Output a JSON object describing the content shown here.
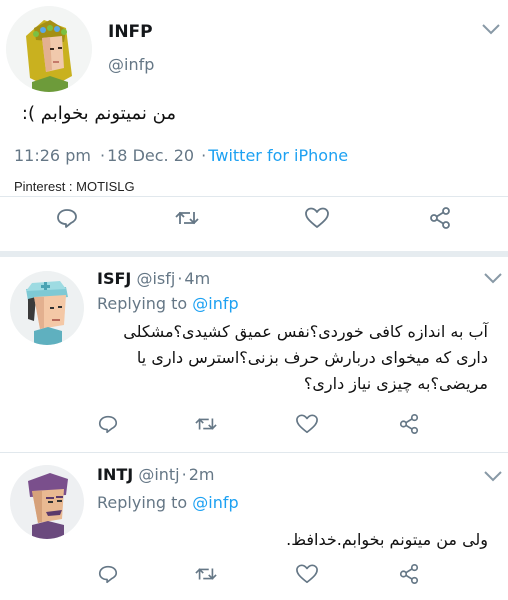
{
  "main_tweet": {
    "display_name": "INFP",
    "handle": "@infp",
    "text": "من نمیتونم بخوابم ):",
    "time": "11:26 pm",
    "date": "18 Dec. 20",
    "separator": "·",
    "source": "Twitter for iPhone",
    "watermark": "Pinterest : MOTISLG"
  },
  "replies": [
    {
      "display_name": "ISFJ",
      "handle": "@isfj",
      "dot": "·",
      "age": "4m",
      "replying_prefix": "Replying to",
      "replying_to": "@infp",
      "lines": [
        "آب به اندازه کافی خوردی؟نفس عمیق کشیدی؟مشکلی",
        "داری که میخوای دربارش حرف بزنی؟استرس داری یا",
        "مریضی؟به چیزی نیاز داری؟"
      ]
    },
    {
      "display_name": "INTJ",
      "handle": "@intj",
      "dot": "·",
      "age": "2m",
      "replying_prefix": "Replying to",
      "replying_to": "@infp",
      "lines": [
        "ولی من میتونم بخوابم.خدافظ."
      ]
    }
  ],
  "actions": [
    "reply-icon",
    "retweet-icon",
    "like-icon",
    "share-icon"
  ],
  "colors": {
    "link": "#1da1f2",
    "secondary": "#657786",
    "icon": "#657786",
    "divider": "#e6ecf0"
  }
}
